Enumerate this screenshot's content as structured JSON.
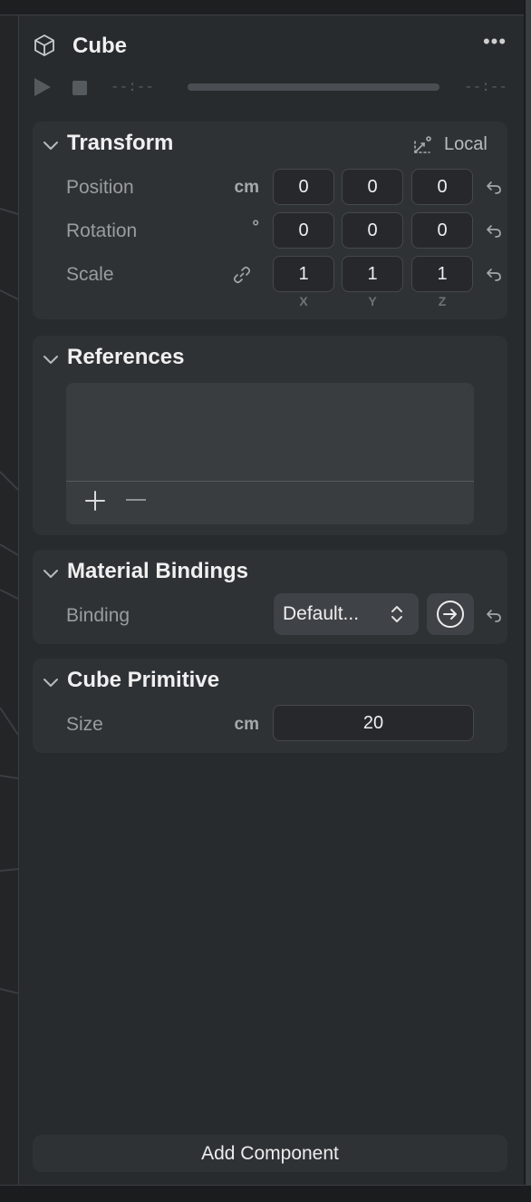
{
  "header": {
    "title": "Cube",
    "more_label": "•••"
  },
  "playback": {
    "time_start": "--:--",
    "time_end": "--:--"
  },
  "transform": {
    "title": "Transform",
    "space_label": "Local",
    "rows": [
      {
        "label": "Position",
        "unit": "cm",
        "x": "0",
        "y": "0",
        "z": "0"
      },
      {
        "label": "Rotation",
        "unit": "°",
        "x": "0",
        "y": "0",
        "z": "0"
      },
      {
        "label": "Scale",
        "unit": "",
        "x": "1",
        "y": "1",
        "z": "1"
      }
    ],
    "axes": {
      "x": "X",
      "y": "Y",
      "z": "Z"
    }
  },
  "references": {
    "title": "References"
  },
  "material_bindings": {
    "title": "Material Bindings",
    "binding_label": "Binding",
    "binding_value": "Default..."
  },
  "cube_primitive": {
    "title": "Cube Primitive",
    "size_label": "Size",
    "size_unit": "cm",
    "size_value": "20"
  },
  "footer": {
    "add_component_label": "Add Component"
  },
  "icons": [
    "cube-icon",
    "more-icon",
    "play-icon",
    "stop-icon",
    "chevron-down-icon",
    "local-space-icon",
    "reset-icon",
    "link-icon",
    "plus-icon",
    "minus-icon",
    "updown-icon",
    "arrow-right-circle-icon"
  ]
}
